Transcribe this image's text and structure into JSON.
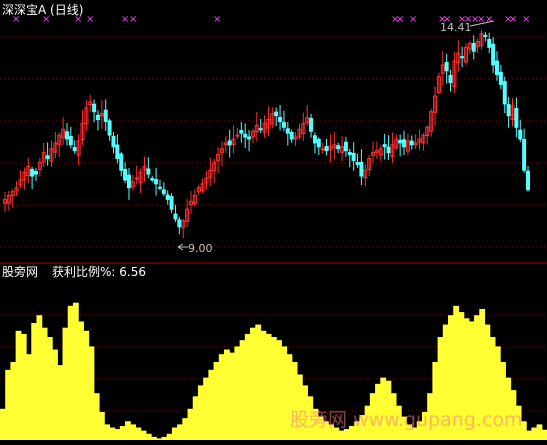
{
  "main_panel": {
    "title": "深深宝A (日线)",
    "high_label": "14.41",
    "low_label": "9.00"
  },
  "sub_panel": {
    "site_label": "股旁网",
    "indicator_label": "获利比例%: 6.56"
  },
  "watermark": "股旁网 www.gupang.com",
  "colors": {
    "up": "#ff3030",
    "down": "#54ffff",
    "marker": "#ff40ff",
    "bars": "#ffff33",
    "grid": "#8a0000",
    "text": "#ffffff",
    "label_text": "#c0c0c0",
    "separator": "#b00000"
  },
  "chart_data": [
    {
      "type": "candlestick",
      "title": "深深宝A (日线)",
      "annotations": [
        {
          "text": "14.41",
          "kind": "high"
        },
        {
          "text": "9.00",
          "kind": "low"
        }
      ],
      "y_range": [
        8.6,
        14.6
      ],
      "close_series": [
        10.05,
        10.15,
        10.25,
        10.35,
        10.55,
        10.75,
        10.9,
        10.65,
        10.7,
        11.0,
        11.25,
        11.1,
        11.35,
        11.5,
        11.7,
        11.85,
        11.6,
        11.45,
        11.3,
        11.55,
        12.0,
        12.4,
        12.55,
        12.3,
        12.1,
        12.25,
        12.05,
        11.7,
        11.4,
        11.1,
        10.8,
        10.55,
        10.35,
        10.5,
        10.6,
        10.75,
        10.9,
        10.7,
        10.55,
        10.45,
        10.35,
        10.2,
        10.05,
        9.8,
        9.55,
        9.35,
        9.5,
        9.8,
        10.0,
        10.15,
        10.35,
        10.45,
        10.6,
        10.8,
        11.0,
        11.2,
        11.35,
        11.5,
        11.45,
        11.6,
        11.7,
        11.75,
        11.65,
        11.6,
        11.8,
        11.95,
        11.85,
        12.0,
        12.1,
        12.25,
        12.2,
        12.05,
        11.9,
        11.75,
        11.6,
        11.65,
        11.85,
        12.0,
        12.15,
        11.8,
        11.5,
        11.4,
        11.35,
        11.3,
        11.4,
        11.45,
        11.35,
        11.4,
        11.3,
        11.2,
        11.05,
        10.95,
        10.65,
        10.8,
        11.1,
        11.25,
        11.3,
        11.35,
        11.4,
        11.25,
        11.45,
        11.6,
        11.5,
        11.4,
        11.55,
        11.45,
        11.5,
        11.6,
        11.7,
        11.9,
        12.3,
        12.7,
        13.2,
        13.5,
        13.35,
        13.05,
        13.6,
        13.8,
        13.7,
        13.95,
        14.05,
        13.85,
        14.1,
        14.3,
        14.25,
        13.95,
        13.5,
        13.25,
        13.0,
        12.5,
        12.2,
        12.45,
        11.9,
        11.6,
        10.8,
        10.3
      ]
    },
    {
      "type": "bar",
      "title": "获利比例%",
      "last_value": 6.56,
      "y_range": [
        0,
        100
      ],
      "values": [
        20,
        45,
        50,
        70,
        68,
        55,
        75,
        80,
        72,
        66,
        58,
        48,
        72,
        86,
        88,
        76,
        70,
        60,
        30,
        18,
        10,
        8,
        7,
        9,
        12,
        10,
        8,
        6,
        4,
        2,
        1,
        2,
        4,
        8,
        10,
        14,
        20,
        28,
        35,
        40,
        45,
        50,
        55,
        58,
        56,
        60,
        64,
        68,
        72,
        74,
        70,
        68,
        66,
        64,
        60,
        55,
        50,
        42,
        35,
        28,
        20,
        15,
        12,
        10,
        8,
        6,
        7,
        9,
        12,
        16,
        22,
        30,
        36,
        40,
        38,
        30,
        22,
        15,
        10,
        8,
        12,
        18,
        30,
        50,
        66,
        74,
        80,
        86,
        82,
        78,
        76,
        80,
        84,
        74,
        66,
        60,
        50,
        40,
        32,
        22,
        12,
        6,
        8,
        10,
        6.56
      ]
    }
  ]
}
